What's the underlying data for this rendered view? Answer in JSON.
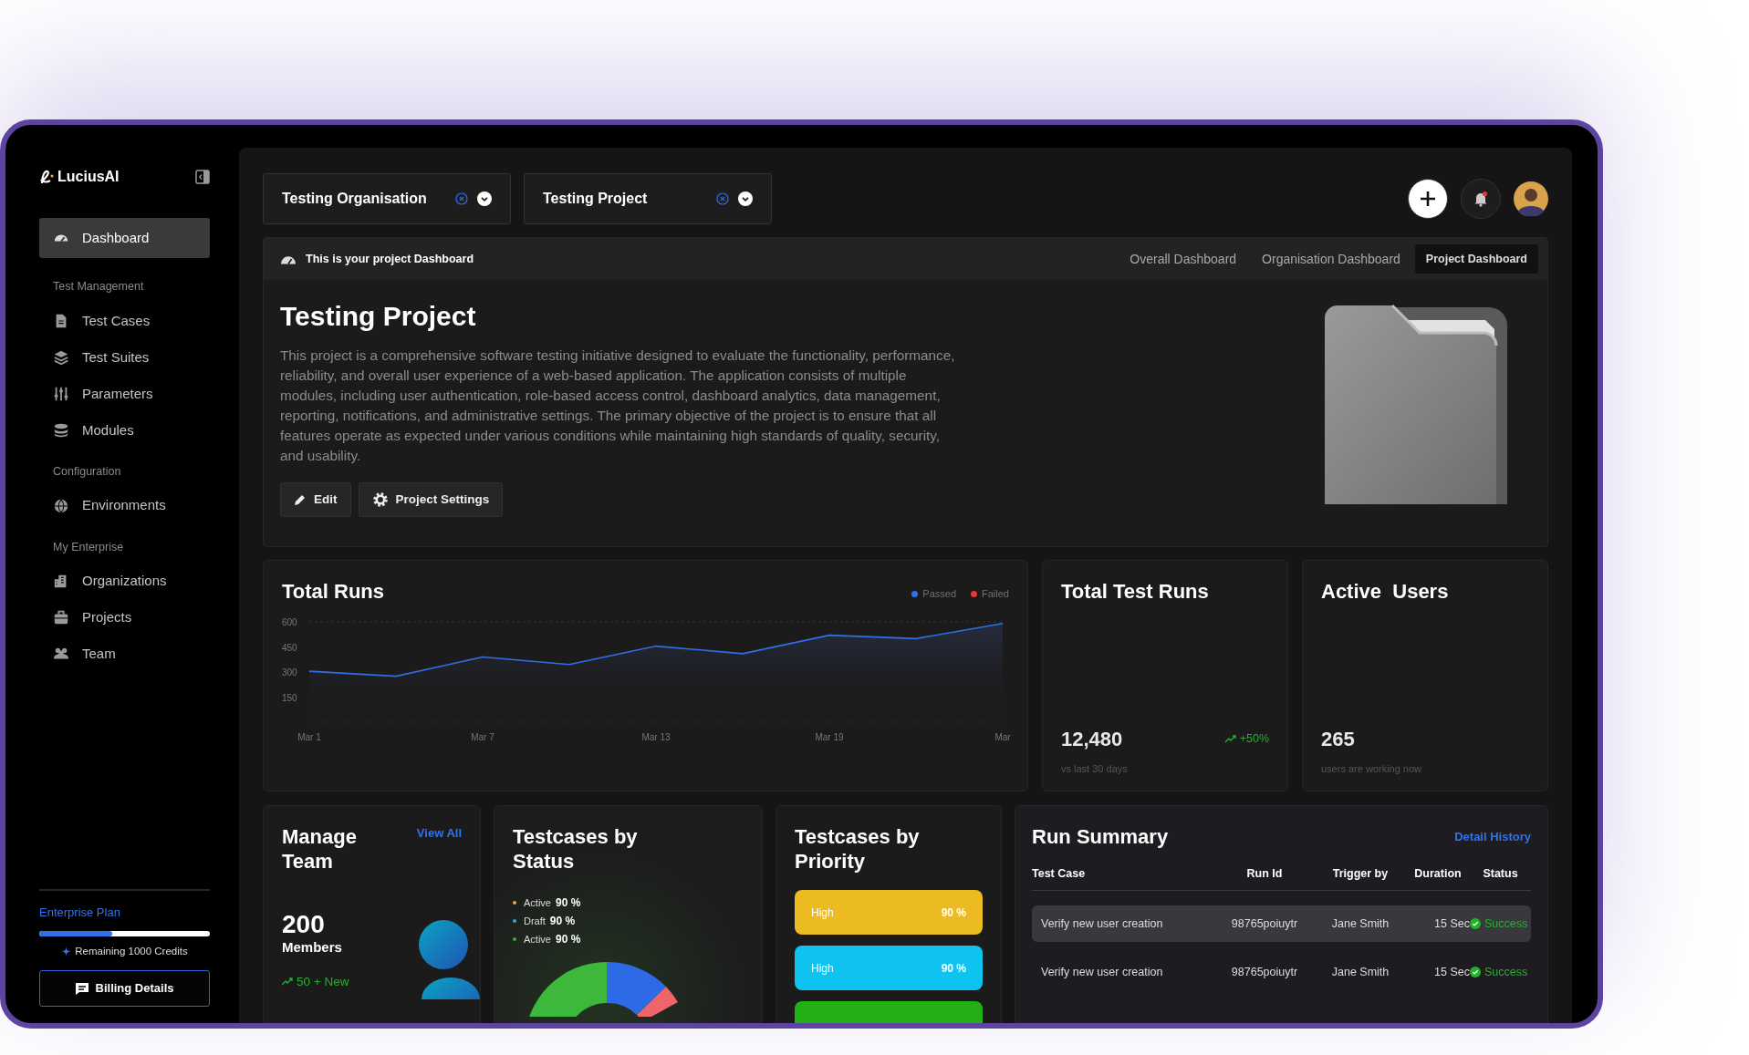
{
  "sidebar": {
    "brand": "LuciusAI",
    "sections": [
      {
        "items": [
          {
            "label": "Dashboard",
            "selected": true
          }
        ]
      },
      {
        "title": "Test Management",
        "items": [
          {
            "label": "Test Cases",
            "selected": false
          },
          {
            "label": "Test Suites",
            "selected": false
          },
          {
            "label": "Parameters",
            "selected": false
          },
          {
            "label": "Modules",
            "selected": false
          }
        ]
      },
      {
        "title": "Configuration",
        "items": [
          {
            "label": "Environments",
            "selected": false
          }
        ]
      },
      {
        "title": "My Enterprise",
        "items": [
          {
            "label": "Organizations",
            "selected": false
          },
          {
            "label": "Projects",
            "selected": false
          },
          {
            "label": "Team",
            "selected": false
          }
        ]
      }
    ],
    "plan": {
      "name": "Enterprise Plan",
      "level": 0.43,
      "credits": "Remaining 1000 Credits",
      "button": "Billing Details"
    }
  },
  "selectors": [
    {
      "value": "Testing Organisation"
    },
    {
      "value": "Testing Project"
    }
  ],
  "project_card": {
    "banner": "This is your project Dashboard",
    "tabs": [
      {
        "label": "Overall Dashboard",
        "selected": false
      },
      {
        "label": "Organisation Dashboard",
        "selected": false
      },
      {
        "label": "Project Dashboard",
        "selected": true
      }
    ],
    "title": "Testing Project",
    "description": "This project is a comprehensive software testing initiative designed to evaluate the functionality, performance, reliability, and overall user experience of a web-based application. The application consists of multiple modules, including user authentication, role-based access control, dashboard analytics, data management, reporting, notifications, and administrative settings. The primary objective of the project is to ensure that all features operate as expected under various conditions while maintaining high standards of quality, security, and usability.",
    "buttons": [
      "Edit",
      "Project Settings"
    ]
  },
  "total_runs": {
    "title": "Total Runs",
    "chart_data": {
      "type": "area",
      "categories": [
        "Mar 1",
        null,
        "Mar 7",
        null,
        "Mar 13",
        null,
        "Mar 19",
        null,
        "Mar"
      ],
      "series": [
        {
          "name": "Passed",
          "color": "#2f6fe8",
          "values": [
            305,
            275,
            390,
            345,
            455,
            410,
            520,
            500,
            590
          ]
        },
        {
          "name": "Failed",
          "color": "#e5392f",
          "values": [
            null,
            null,
            null,
            null,
            null,
            null,
            null,
            null,
            null
          ]
        }
      ],
      "ylim": [
        0,
        600
      ],
      "yticks": [
        150,
        300,
        450,
        600
      ]
    }
  },
  "total_test_runs": {
    "title": "Total Test Runs",
    "value": "12,480",
    "change": "+50%",
    "caption": "vs last 30 days"
  },
  "active_users": {
    "title": "Active  Users",
    "value": "265",
    "caption": "users are working now"
  },
  "manage_team": {
    "title": "Manage Team",
    "link": "View All",
    "count": "200",
    "unit": "Members",
    "new": "50 + New"
  },
  "status_card": {
    "title": "Testcases by Status",
    "legend": [
      {
        "label": "Active",
        "value": "90 %",
        "color": "#e0a84a"
      },
      {
        "label": "Draft",
        "value": "90 %",
        "color": "#2aa5e0"
      },
      {
        "label": "Active",
        "value": "90 %",
        "color": "#35b03a"
      }
    ]
  },
  "priority_card": {
    "title": "Testcases by Priority",
    "bars": [
      {
        "label": "High",
        "value": "90 %",
        "color": "#ecbb22"
      },
      {
        "label": "High",
        "value": "90 %",
        "color": "#0ec3ef"
      },
      {
        "color": "#22b014"
      }
    ]
  },
  "run_summary": {
    "title": "Run Summary",
    "link": "Detail History",
    "columns": [
      "Test Case",
      "Run Id",
      "Trigger by",
      "Duration",
      "Status"
    ],
    "rows": [
      {
        "cells": [
          "Verify new user creation",
          "98765poiuytr",
          "Jane Smith",
          "15 Sec"
        ],
        "status": "Success",
        "selected": true
      },
      {
        "cells": [
          "Verify new user creation",
          "98765poiuytr",
          "Jane Smith",
          "15 Sec"
        ],
        "status": "Success",
        "selected": false
      }
    ]
  }
}
